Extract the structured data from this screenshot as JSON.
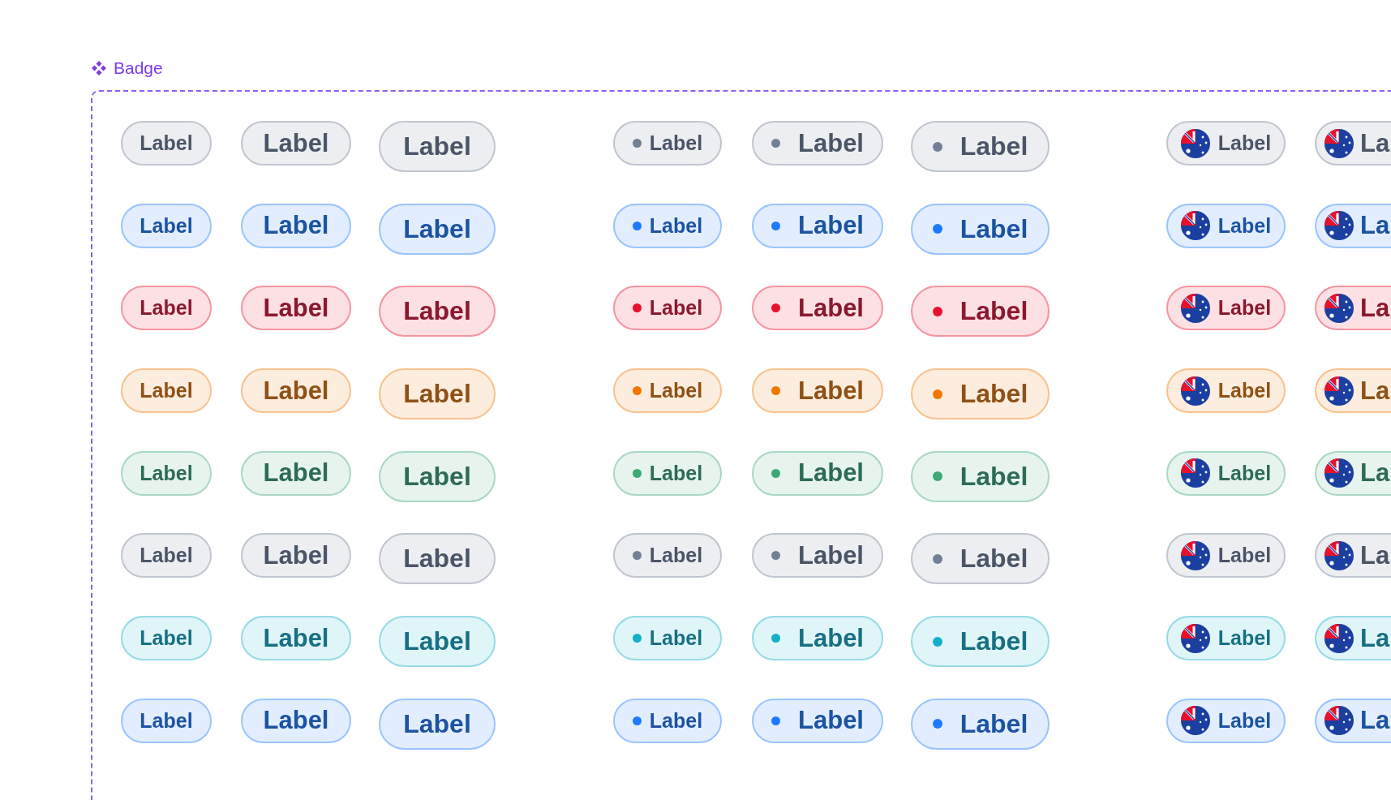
{
  "component": {
    "title": "Badge"
  },
  "rows": [
    {
      "color": "#718096",
      "badges": [
        {
          "kind": "plain",
          "label": "Label"
        },
        {
          "kind": "plain",
          "label": "Label"
        },
        {
          "kind": "plain",
          "label": "Label"
        },
        {
          "kind": "dot",
          "label": "Label"
        },
        {
          "kind": "dot",
          "label": "Label"
        },
        {
          "kind": "dot",
          "label": "Label"
        },
        {
          "kind": "flag",
          "label": "Label"
        },
        {
          "kind": "flag",
          "label": "La"
        }
      ]
    },
    {
      "color": "#1e7bff",
      "badges": [
        {
          "kind": "plain",
          "label": "Label"
        },
        {
          "kind": "plain",
          "label": "Label"
        },
        {
          "kind": "plain",
          "label": "Label"
        },
        {
          "kind": "dot",
          "label": "Label"
        },
        {
          "kind": "dot",
          "label": "Label"
        },
        {
          "kind": "dot",
          "label": "Label"
        },
        {
          "kind": "flag",
          "label": "Label"
        },
        {
          "kind": "flag",
          "label": "La"
        }
      ]
    },
    {
      "color": "#e8112d",
      "badges": [
        {
          "kind": "plain",
          "label": "Label"
        },
        {
          "kind": "plain",
          "label": "Label"
        },
        {
          "kind": "plain",
          "label": "Label"
        },
        {
          "kind": "dot",
          "label": "Label"
        },
        {
          "kind": "dot",
          "label": "Label"
        },
        {
          "kind": "dot",
          "label": "Label"
        },
        {
          "kind": "flag",
          "label": "Label"
        },
        {
          "kind": "flag",
          "label": "La"
        }
      ]
    },
    {
      "color": "#f07800",
      "badges": [
        {
          "kind": "plain",
          "label": "Label"
        },
        {
          "kind": "plain",
          "label": "Label"
        },
        {
          "kind": "plain",
          "label": "Label"
        },
        {
          "kind": "dot",
          "label": "Label"
        },
        {
          "kind": "dot",
          "label": "Label"
        },
        {
          "kind": "dot",
          "label": "Label"
        },
        {
          "kind": "flag",
          "label": "Label"
        },
        {
          "kind": "flag",
          "label": "La"
        }
      ]
    },
    {
      "color": "#3ea876",
      "badges": [
        {
          "kind": "plain",
          "label": "Label"
        },
        {
          "kind": "plain",
          "label": "Label"
        },
        {
          "kind": "plain",
          "label": "Label"
        },
        {
          "kind": "dot",
          "label": "Label"
        },
        {
          "kind": "dot",
          "label": "Label"
        },
        {
          "kind": "dot",
          "label": "Label"
        },
        {
          "kind": "flag",
          "label": "Label"
        },
        {
          "kind": "flag",
          "label": "La"
        }
      ]
    },
    {
      "color": "#718096",
      "badges": [
        {
          "kind": "plain",
          "label": "Label"
        },
        {
          "kind": "plain",
          "label": "Label"
        },
        {
          "kind": "plain",
          "label": "Label"
        },
        {
          "kind": "dot",
          "label": "Label"
        },
        {
          "kind": "dot",
          "label": "Label"
        },
        {
          "kind": "dot",
          "label": "Label"
        },
        {
          "kind": "flag",
          "label": "Label"
        },
        {
          "kind": "flag",
          "label": "La"
        }
      ]
    },
    {
      "color": "#14b0c8",
      "badges": [
        {
          "kind": "plain",
          "label": "Label"
        },
        {
          "kind": "plain",
          "label": "Label"
        },
        {
          "kind": "plain",
          "label": "Label"
        },
        {
          "kind": "dot",
          "label": "Label"
        },
        {
          "kind": "dot",
          "label": "Label"
        },
        {
          "kind": "dot",
          "label": "Label"
        },
        {
          "kind": "flag",
          "label": "Label"
        },
        {
          "kind": "flag",
          "label": "La"
        }
      ]
    },
    {
      "color": "#1e7bff",
      "badges": [
        {
          "kind": "plain",
          "label": "Label"
        },
        {
          "kind": "plain",
          "label": "Label"
        },
        {
          "kind": "plain",
          "label": "Label"
        },
        {
          "kind": "dot",
          "label": "Label"
        },
        {
          "kind": "dot",
          "label": "Label"
        },
        {
          "kind": "dot",
          "label": "Label"
        },
        {
          "kind": "flag",
          "label": "Label"
        },
        {
          "kind": "flag",
          "label": "La"
        }
      ]
    }
  ]
}
